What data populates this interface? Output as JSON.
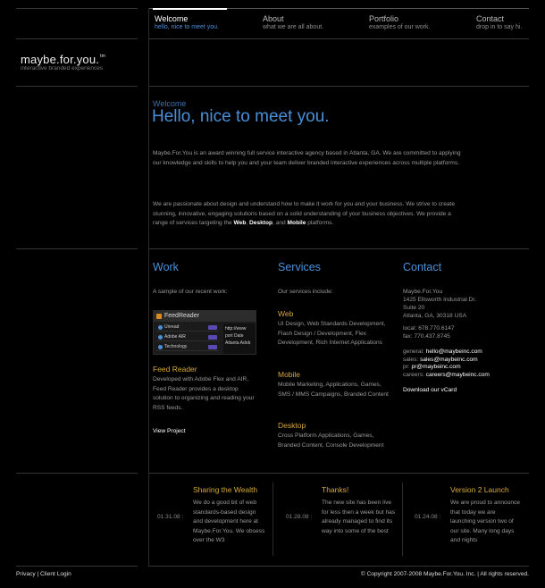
{
  "nav": [
    {
      "title": "Welcome",
      "sub": "hello, nice to meet you."
    },
    {
      "title": "About",
      "sub": "what we are all about."
    },
    {
      "title": "Portfolio",
      "sub": "examples of our work."
    },
    {
      "title": "Contact",
      "sub": "drop in to say hi."
    }
  ],
  "brand": {
    "name": "maybe.for.you.",
    "tm": "tm",
    "tagline": "interactive branded experiences"
  },
  "welcome": {
    "eyebrow": "Welcome",
    "headline": "Hello, nice to meet you.",
    "para1": "Maybe.For.You is an award winning full service interactive agency based in Atlanta, GA. We are committed to applying our knowledge and skills to help you and your team deliver branded interactive experiences across multiple platforms.",
    "para2_pre": "We are passionate about design and understand how to make it work for you and your business. We strive to create stunning, innovative, engaging solutions based on a solid understanding of your business objectives. We provide a range of services targeting the ",
    "para2_web": "Web",
    "para2_sep1": ", ",
    "para2_desktop": "Desktop",
    "para2_sep2": ", and ",
    "para2_mobile": "Mobile",
    "para2_post": " platforms."
  },
  "work": {
    "heading": "Work",
    "intro": "A sample of our recent work:",
    "thumb": {
      "title": "FeedReader",
      "rows": [
        "Unread",
        "Adobe AIR",
        "Technology"
      ],
      "pane_lines": [
        "http://www",
        "port  Date",
        "Atlanta Adob"
      ]
    },
    "project_title": "Feed Reader",
    "project_desc": "Developed with Adobe Flex and AIR, Feed Reader provides a desktop solution to organizing and reading your RSS feeds.",
    "link": "View Project"
  },
  "services": {
    "heading": "Services",
    "intro": "Our services include:",
    "items": [
      {
        "title": "Web",
        "desc": "UI Design, Web Standards Development, Flash Design / Development, Flex Development, Rich Internet Applications"
      },
      {
        "title": "Mobile",
        "desc": "Mobile Marketing, Applications, Games, SMS / MMS Campaigns, Branded Content"
      },
      {
        "title": "Desktop",
        "desc": "Cross Platform Applications, Games, Branded Content, Console Development"
      }
    ]
  },
  "contact": {
    "heading": "Contact",
    "company": "Maybe.For.You",
    "address1": "1425 Ellsworth Industrial Dr.",
    "address2": "Suite 20",
    "address3": "Atlanta, GA, 30318 USA",
    "local": "local: 678.770.6147",
    "fax": "fax: 770.437.8745",
    "emails": [
      {
        "label": "general: ",
        "email": "hello@maybeinc.com"
      },
      {
        "label": "sales: ",
        "email": "sales@maybeinc.com"
      },
      {
        "label": "pr: ",
        "email": "pr@maybeinc.com"
      },
      {
        "label": "careers: ",
        "email": "careers@maybeinc.com"
      }
    ],
    "vcard": "Download our vCard"
  },
  "news": [
    {
      "date": "01.31.08 :",
      "title": "Sharing the Wealth",
      "body": "We do a good bit of web standards-based design and development here at Maybe.For.You. We obsess over the W3"
    },
    {
      "date": "01.28.08 :",
      "title": "Thanks!",
      "body": "The new site has been live for less then a  week but has already managed to find its way into some of the best"
    },
    {
      "date": "01.24.08 :",
      "title": "Version 2 Launch",
      "body": "We are proud to announce that today we are launching version two of our site. Many long days and nights"
    }
  ],
  "footer": {
    "privacy": "Privacy",
    "sep": "|",
    "client_login": "Client Login",
    "copyright": "© Copyright 2007-2008 Maybe.For.You. Inc. | All rights reserved."
  },
  "colors": {
    "accent_blue": "#4a8fd8",
    "accent_gold": "#d6a73b",
    "bg": "#000000"
  }
}
